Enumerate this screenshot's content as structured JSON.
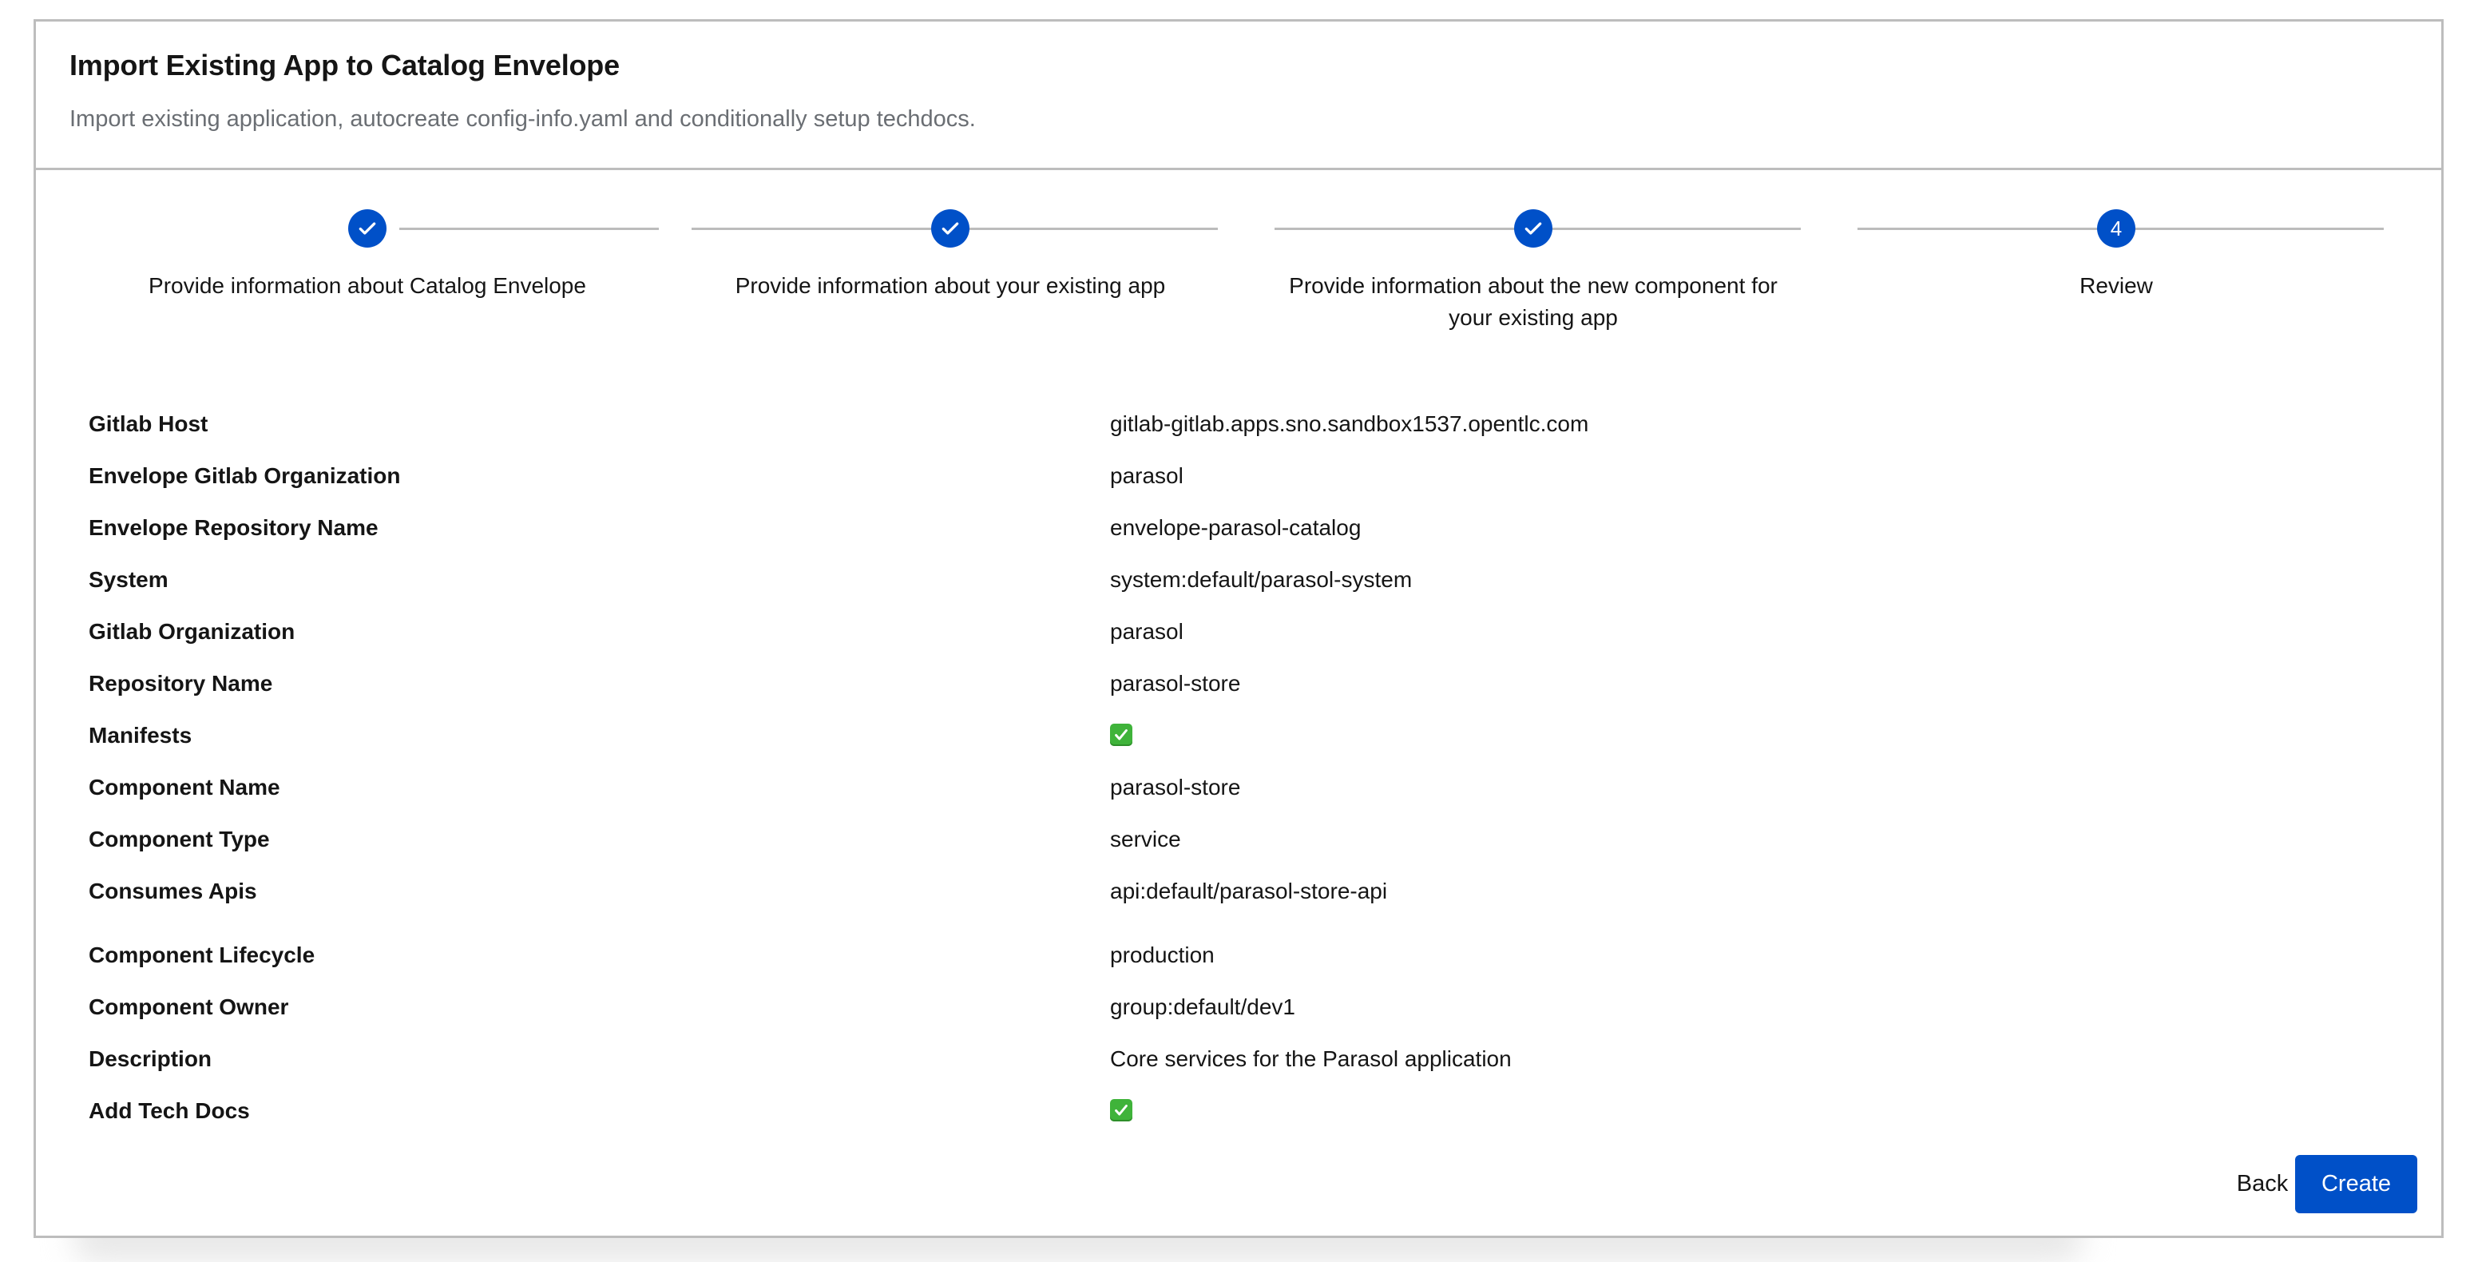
{
  "header": {
    "title": "Import Existing App to Catalog Envelope",
    "subtitle": "Import existing application, autocreate config-info.yaml and conditionally setup techdocs."
  },
  "stepper": {
    "accent_color": "#0050c8",
    "steps": [
      {
        "label": "Provide information about Catalog Envelope",
        "status": "completed",
        "icon": "check-icon"
      },
      {
        "label": "Provide information about your existing app",
        "status": "completed",
        "icon": "check-icon"
      },
      {
        "label": "Provide information about the new component for your existing app",
        "status": "completed",
        "icon": "check-icon"
      },
      {
        "label": "Review",
        "status": "current",
        "number": "4"
      }
    ]
  },
  "review": {
    "rows": [
      {
        "key": "Gitlab Host",
        "value": "gitlab-gitlab.apps.sno.sandbox1537.opentlc.com"
      },
      {
        "key": "Envelope Gitlab Organization",
        "value": "parasol"
      },
      {
        "key": "Envelope Repository Name",
        "value": "envelope-parasol-catalog"
      },
      {
        "key": "System",
        "value": "system:default/parasol-system"
      },
      {
        "key": "Gitlab Organization",
        "value": "parasol"
      },
      {
        "key": "Repository Name",
        "value": "parasol-store"
      },
      {
        "key": "Manifests",
        "value": "✅",
        "icon": "check-mark-button-icon"
      },
      {
        "key": "Component Name",
        "value": "parasol-store"
      },
      {
        "key": "Component Type",
        "value": "service"
      },
      {
        "key": "Consumes Apis",
        "value": "api:default/parasol-store-api"
      },
      {
        "key": "Component Lifecycle",
        "value": "production"
      },
      {
        "key": "Component Owner",
        "value": "group:default/dev1"
      },
      {
        "key": "Description",
        "value": "Core services for the Parasol application"
      },
      {
        "key": "Add Tech Docs",
        "value": "✅",
        "icon": "check-mark-button-icon"
      }
    ]
  },
  "footer": {
    "back_label": "Back",
    "create_label": "Create"
  }
}
